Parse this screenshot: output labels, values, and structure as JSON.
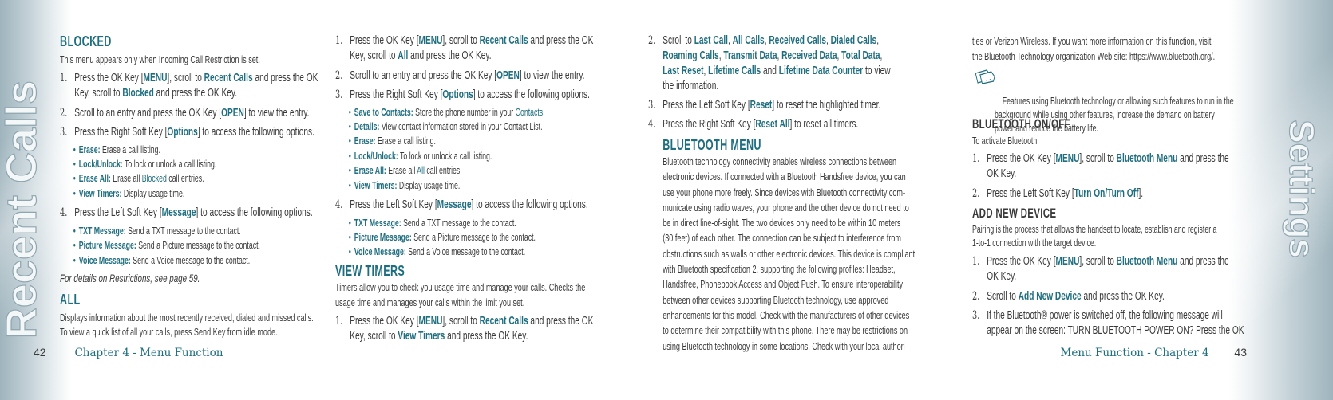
{
  "left_page": {
    "side_title": "Recent Calls",
    "page_number": "42",
    "chapter": "Chapter 4 - Menu Function",
    "blocked": {
      "heading": "BLOCKED",
      "intro": "This menu appears only when Incoming Call Restriction is set.",
      "steps": [
        "Press the OK Key [«MENU»], scroll to «Recent Calls» and press the OK\nKey, scroll to «Blocked» and press the OK Key.",
        "Scroll to an entry and press the OK Key [«OPEN»] to view the entry.",
        "Press the Right Soft Key [«Options»] to access the following options.",
        "Press the Left Soft Key [«Message»] to access the following options."
      ],
      "options": [
        "«Erase:» Erase a call listing.",
        "«Lock/Unlock:» To lock or unlock a call listing.",
        "«Erase All:» Erase all ‹Blocked› call entries.",
        "«View Timers:» Display usage time."
      ],
      "message_options": [
        "«TXT Message:» Send a TXT message to the contact.",
        "«Picture Message:» Send a Picture message to the contact.",
        "«Voice Message:» Send a Voice message to the contact."
      ],
      "note": "For details on Restrictions, see page 59."
    },
    "all": {
      "heading": "ALL",
      "para": "Displays information about the most recently received, dialed and missed calls.\nTo view a quick list of all your calls, press Send Key from idle mode.",
      "steps": [
        "Press the OK Key [«MENU»], scroll to «Recent Calls» and press the OK\nKey, scroll to «All» and press the OK Key.",
        "Scroll to an entry and press the OK Key [«OPEN»] to view the entry.",
        "Press the Right Soft Key [«Options»] to access the following options.",
        "Press the Left Soft Key [«Message»] to access the following options."
      ],
      "options": [
        "«Save to Contacts:» Store the phone number in your ‹Contacts›.",
        "«Details:» View contact information stored in your Contact List.",
        "«Erase:» Erase a call listing.",
        "«Lock/Unlock:» To lock or unlock a call listing.",
        "«Erase All:» Erase all ‹All› call entries.",
        "«View Timers:» Display usage time."
      ],
      "message_options": [
        "«TXT Message:» Send a TXT message to the contact.",
        "«Picture Message:» Send a Picture message to the contact.",
        "«Voice Message:» Send a Voice message to the contact."
      ]
    },
    "view_timers": {
      "heading": "VIEW TIMERS",
      "para": "Timers allow you to check you usage time and manage your calls. Checks the\nusage time and manages your calls within the limit you set.",
      "step1": "Press the OK Key [«MENU»], scroll to «Recent Calls» and press the OK\nKey, scroll to «View Timers» and press the OK Key."
    }
  },
  "right_page": {
    "side_title": "Settings",
    "page_number": "43",
    "chapter": "Menu Function - Chapter 4",
    "view_timers_cont": {
      "steps": [
        "Scroll to «Last Call», «All Calls», «Received Calls», «Dialed Calls»,\n«Roaming Calls», «Transmit Data», «Received Data», «Total Data»,\n«Last Reset», «Lifetime Calls» and «Lifetime Data Counter» to view\nthe information.",
        "Press the Left Soft Key [«Reset»] to reset the highlighted timer.",
        "Press the Right Soft Key [«Reset All»] to reset all timers."
      ]
    },
    "bluetooth_menu": {
      "heading": "BLUETOOTH MENU",
      "para": "Bluetooth technology connectivity enables wireless connections between\nelectronic devices. If connected with a Bluetooth Handsfree device, you can\nuse your phone more freely. Since devices with Bluetooth connectivity com-\nmunicate using radio waves, your phone and the other device do not need to\nbe in direct line-of-sight. The two devices only need to be within 10 meters\n(30 feet) of each other. The connection can be subject to interference from\nobstructions such as walls or other electronic devices. This device is compliant\nwith Bluetooth specification 2, supporting the following profiles: Headset,\nHandsfree, Phonebook Access and Object Push. To ensure interoperability\nbetween other devices supporting Bluetooth technology, use approved\nenhancements for this model. Check with the manufacturers of other devices\nto determine their compatibility with this phone. There may be restrictions on\nusing Bluetooth technology in some locations. Check with your local authori-",
      "para_cont": "ties or Verizon Wireless. If you want more information on this function, visit\nthe Bluetooth Technology organization Web site: https://www.bluetooth.org/.",
      "note": "Features using Bluetooth technology or allowing such features to run in the\nbackground while using other features, increase the demand on battery\npower and reduce the battery life.",
      "note_icon": "note-cards-icon"
    },
    "bluetooth_onoff": {
      "heading": "BLUETOOTH ON/OFF",
      "intro": "To activate Bluetooth:",
      "steps": [
        "Press the OK Key [«MENU»], scroll to «Bluetooth Menu» and press the\nOK Key.",
        "Press the Left Soft Key [«Turn On/Turn Off»]."
      ]
    },
    "add_new_device": {
      "heading": "ADD NEW DEVICE",
      "para": "Pairing is the process that allows the handset to locate, establish and register a\n1-to-1 connection with the target device.",
      "steps": [
        "Press the OK Key [«MENU»], scroll to «Bluetooth Menu» and press the\nOK Key.",
        "Scroll to «Add New Device» and press the OK Key.",
        "If the Bluetooth® power is switched off, the following message will\nappear on the screen: TURN BLUETOOTH POWER ON? Press the OK"
      ]
    }
  },
  "colors": {
    "accent": "#1f6e80",
    "text": "#3a3a3a",
    "band": "#9fb4bd"
  },
  "step_numbers": [
    "1.",
    "2.",
    "3.",
    "4."
  ]
}
